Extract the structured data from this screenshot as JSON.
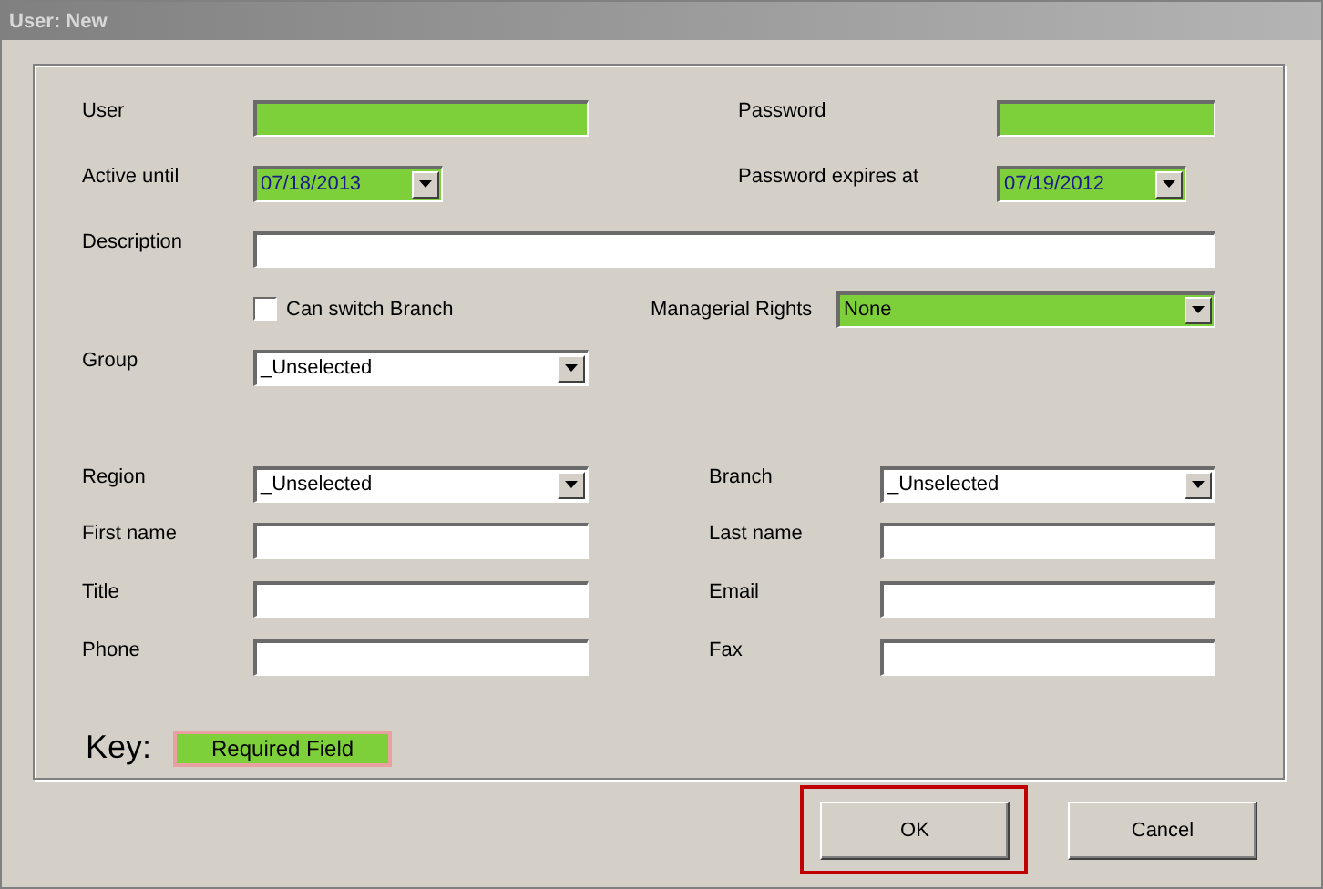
{
  "window": {
    "title": "User: New"
  },
  "rows": [
    {
      "left": {
        "kind": "text",
        "label": "User",
        "required": true
      },
      "right": {
        "kind": "text",
        "label": "Password",
        "required": true
      }
    },
    {
      "left": {
        "kind": "date",
        "label": "Active until",
        "value": "07/18/2013",
        "required": true
      },
      "right": {
        "kind": "date",
        "label": "Password expires at",
        "value": "07/19/2012",
        "required": true
      }
    },
    {
      "left": {
        "kind": "text",
        "label": "Description",
        "required": false
      }
    },
    {
      "left": {
        "kind": "checkbox",
        "label": "Can switch Branch",
        "checked": false
      },
      "right": {
        "kind": "dropdown",
        "label": "Managerial Rights",
        "value": "None",
        "required": true
      }
    },
    {
      "left": {
        "kind": "dropdown",
        "label": "Group",
        "value": "_Unselected",
        "required": false
      }
    },
    {
      "left": {
        "kind": "dropdown",
        "label": "Region",
        "value": "_Unselected",
        "required": false
      },
      "right": {
        "kind": "dropdown",
        "label": "Branch",
        "value": "_Unselected",
        "required": false
      }
    },
    {
      "left": {
        "kind": "text",
        "label": "First name",
        "required": false
      },
      "right": {
        "kind": "text",
        "label": "Last name",
        "required": false
      }
    },
    {
      "left": {
        "kind": "text",
        "label": "Title",
        "required": false
      },
      "right": {
        "kind": "text",
        "label": "Email",
        "required": false
      }
    },
    {
      "left": {
        "kind": "text",
        "label": "Phone",
        "required": false
      },
      "right": {
        "kind": "text",
        "label": "Fax",
        "required": false
      }
    }
  ],
  "key": {
    "label": "Key:",
    "sample": "Required Field"
  },
  "buttons": [
    {
      "label": "OK",
      "highlighted": true
    },
    {
      "label": "Cancel",
      "highlighted": false
    }
  ]
}
